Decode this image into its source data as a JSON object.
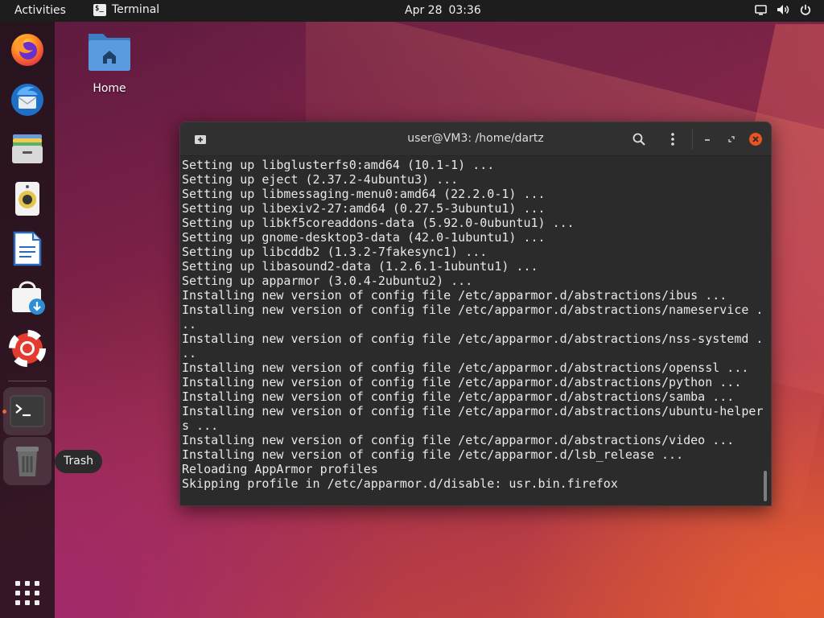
{
  "topbar": {
    "activities": "Activities",
    "app_name": "Terminal",
    "date": "Apr 28",
    "time": "03:36"
  },
  "dock": {
    "items": [
      "firefox-icon",
      "thunderbird-icon",
      "files-icon",
      "rhythmbox-icon",
      "libreoffice-writer-icon",
      "software-center-icon",
      "help-icon",
      "terminal-icon",
      "trash-icon"
    ],
    "tooltip": "Trash"
  },
  "desktop": {
    "home_label": "Home"
  },
  "terminal": {
    "title": "user@VM3: /home/dartz",
    "lines": [
      "Setting up libglusterfs0:amd64 (10.1-1) ...",
      "Setting up eject (2.37.2-4ubuntu3) ...",
      "Setting up libmessaging-menu0:amd64 (22.2.0-1) ...",
      "Setting up libexiv2-27:amd64 (0.27.5-3ubuntu1) ...",
      "Setting up libkf5coreaddons-data (5.92.0-0ubuntu1) ...",
      "Setting up gnome-desktop3-data (42.0-1ubuntu1) ...",
      "Setting up libcddb2 (1.3.2-7fakesync1) ...",
      "Setting up libasound2-data (1.2.6.1-1ubuntu1) ...",
      "Setting up apparmor (3.0.4-2ubuntu2) ...",
      "Installing new version of config file /etc/apparmor.d/abstractions/ibus ...",
      "Installing new version of config file /etc/apparmor.d/abstractions/nameservice .",
      "..",
      "Installing new version of config file /etc/apparmor.d/abstractions/nss-systemd .",
      "..",
      "Installing new version of config file /etc/apparmor.d/abstractions/openssl ...",
      "Installing new version of config file /etc/apparmor.d/abstractions/python ...",
      "Installing new version of config file /etc/apparmor.d/abstractions/samba ...",
      "Installing new version of config file /etc/apparmor.d/abstractions/ubuntu-helper",
      "s ...",
      "Installing new version of config file /etc/apparmor.d/abstractions/video ...",
      "Installing new version of config file /etc/apparmor.d/lsb_release ...",
      "Reloading AppArmor profiles",
      "Skipping profile in /etc/apparmor.d/disable: usr.bin.firefox"
    ]
  },
  "colors": {
    "accent": "#e95420",
    "topbar": "#1d1d1d",
    "terminal_bg": "#2b2b2b"
  }
}
